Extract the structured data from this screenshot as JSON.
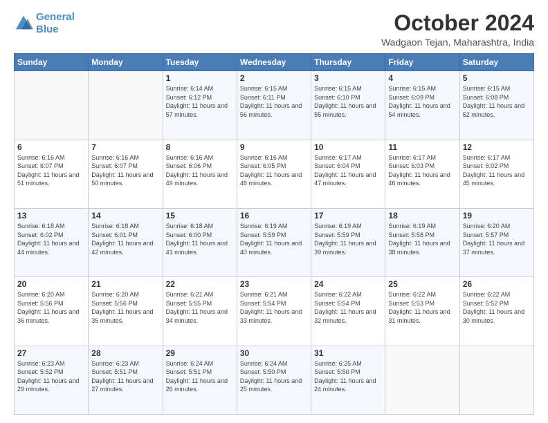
{
  "header": {
    "logo_line1": "General",
    "logo_line2": "Blue",
    "month": "October 2024",
    "location": "Wadgaon Tejan, Maharashtra, India"
  },
  "days_of_week": [
    "Sunday",
    "Monday",
    "Tuesday",
    "Wednesday",
    "Thursday",
    "Friday",
    "Saturday"
  ],
  "weeks": [
    [
      {
        "day": "",
        "sunrise": "",
        "sunset": "",
        "daylight": ""
      },
      {
        "day": "",
        "sunrise": "",
        "sunset": "",
        "daylight": ""
      },
      {
        "day": "1",
        "sunrise": "Sunrise: 6:14 AM",
        "sunset": "Sunset: 6:12 PM",
        "daylight": "Daylight: 11 hours and 57 minutes."
      },
      {
        "day": "2",
        "sunrise": "Sunrise: 6:15 AM",
        "sunset": "Sunset: 6:11 PM",
        "daylight": "Daylight: 11 hours and 56 minutes."
      },
      {
        "day": "3",
        "sunrise": "Sunrise: 6:15 AM",
        "sunset": "Sunset: 6:10 PM",
        "daylight": "Daylight: 11 hours and 55 minutes."
      },
      {
        "day": "4",
        "sunrise": "Sunrise: 6:15 AM",
        "sunset": "Sunset: 6:09 PM",
        "daylight": "Daylight: 11 hours and 54 minutes."
      },
      {
        "day": "5",
        "sunrise": "Sunrise: 6:15 AM",
        "sunset": "Sunset: 6:08 PM",
        "daylight": "Daylight: 11 hours and 52 minutes."
      }
    ],
    [
      {
        "day": "6",
        "sunrise": "Sunrise: 6:16 AM",
        "sunset": "Sunset: 6:07 PM",
        "daylight": "Daylight: 11 hours and 51 minutes."
      },
      {
        "day": "7",
        "sunrise": "Sunrise: 6:16 AM",
        "sunset": "Sunset: 6:07 PM",
        "daylight": "Daylight: 11 hours and 50 minutes."
      },
      {
        "day": "8",
        "sunrise": "Sunrise: 6:16 AM",
        "sunset": "Sunset: 6:06 PM",
        "daylight": "Daylight: 11 hours and 49 minutes."
      },
      {
        "day": "9",
        "sunrise": "Sunrise: 6:16 AM",
        "sunset": "Sunset: 6:05 PM",
        "daylight": "Daylight: 11 hours and 48 minutes."
      },
      {
        "day": "10",
        "sunrise": "Sunrise: 6:17 AM",
        "sunset": "Sunset: 6:04 PM",
        "daylight": "Daylight: 11 hours and 47 minutes."
      },
      {
        "day": "11",
        "sunrise": "Sunrise: 6:17 AM",
        "sunset": "Sunset: 6:03 PM",
        "daylight": "Daylight: 11 hours and 46 minutes."
      },
      {
        "day": "12",
        "sunrise": "Sunrise: 6:17 AM",
        "sunset": "Sunset: 6:02 PM",
        "daylight": "Daylight: 11 hours and 45 minutes."
      }
    ],
    [
      {
        "day": "13",
        "sunrise": "Sunrise: 6:18 AM",
        "sunset": "Sunset: 6:02 PM",
        "daylight": "Daylight: 11 hours and 44 minutes."
      },
      {
        "day": "14",
        "sunrise": "Sunrise: 6:18 AM",
        "sunset": "Sunset: 6:01 PM",
        "daylight": "Daylight: 11 hours and 42 minutes."
      },
      {
        "day": "15",
        "sunrise": "Sunrise: 6:18 AM",
        "sunset": "Sunset: 6:00 PM",
        "daylight": "Daylight: 11 hours and 41 minutes."
      },
      {
        "day": "16",
        "sunrise": "Sunrise: 6:19 AM",
        "sunset": "Sunset: 5:59 PM",
        "daylight": "Daylight: 11 hours and 40 minutes."
      },
      {
        "day": "17",
        "sunrise": "Sunrise: 6:19 AM",
        "sunset": "Sunset: 5:59 PM",
        "daylight": "Daylight: 11 hours and 39 minutes."
      },
      {
        "day": "18",
        "sunrise": "Sunrise: 6:19 AM",
        "sunset": "Sunset: 5:58 PM",
        "daylight": "Daylight: 11 hours and 38 minutes."
      },
      {
        "day": "19",
        "sunrise": "Sunrise: 6:20 AM",
        "sunset": "Sunset: 5:57 PM",
        "daylight": "Daylight: 11 hours and 37 minutes."
      }
    ],
    [
      {
        "day": "20",
        "sunrise": "Sunrise: 6:20 AM",
        "sunset": "Sunset: 5:56 PM",
        "daylight": "Daylight: 11 hours and 36 minutes."
      },
      {
        "day": "21",
        "sunrise": "Sunrise: 6:20 AM",
        "sunset": "Sunset: 5:56 PM",
        "daylight": "Daylight: 11 hours and 35 minutes."
      },
      {
        "day": "22",
        "sunrise": "Sunrise: 6:21 AM",
        "sunset": "Sunset: 5:55 PM",
        "daylight": "Daylight: 11 hours and 34 minutes."
      },
      {
        "day": "23",
        "sunrise": "Sunrise: 6:21 AM",
        "sunset": "Sunset: 5:54 PM",
        "daylight": "Daylight: 11 hours and 33 minutes."
      },
      {
        "day": "24",
        "sunrise": "Sunrise: 6:22 AM",
        "sunset": "Sunset: 5:54 PM",
        "daylight": "Daylight: 11 hours and 32 minutes."
      },
      {
        "day": "25",
        "sunrise": "Sunrise: 6:22 AM",
        "sunset": "Sunset: 5:53 PM",
        "daylight": "Daylight: 11 hours and 31 minutes."
      },
      {
        "day": "26",
        "sunrise": "Sunrise: 6:22 AM",
        "sunset": "Sunset: 5:52 PM",
        "daylight": "Daylight: 11 hours and 30 minutes."
      }
    ],
    [
      {
        "day": "27",
        "sunrise": "Sunrise: 6:23 AM",
        "sunset": "Sunset: 5:52 PM",
        "daylight": "Daylight: 11 hours and 29 minutes."
      },
      {
        "day": "28",
        "sunrise": "Sunrise: 6:23 AM",
        "sunset": "Sunset: 5:51 PM",
        "daylight": "Daylight: 11 hours and 27 minutes."
      },
      {
        "day": "29",
        "sunrise": "Sunrise: 6:24 AM",
        "sunset": "Sunset: 5:51 PM",
        "daylight": "Daylight: 11 hours and 26 minutes."
      },
      {
        "day": "30",
        "sunrise": "Sunrise: 6:24 AM",
        "sunset": "Sunset: 5:50 PM",
        "daylight": "Daylight: 11 hours and 25 minutes."
      },
      {
        "day": "31",
        "sunrise": "Sunrise: 6:25 AM",
        "sunset": "Sunset: 5:50 PM",
        "daylight": "Daylight: 11 hours and 24 minutes."
      },
      {
        "day": "",
        "sunrise": "",
        "sunset": "",
        "daylight": ""
      },
      {
        "day": "",
        "sunrise": "",
        "sunset": "",
        "daylight": ""
      }
    ]
  ]
}
